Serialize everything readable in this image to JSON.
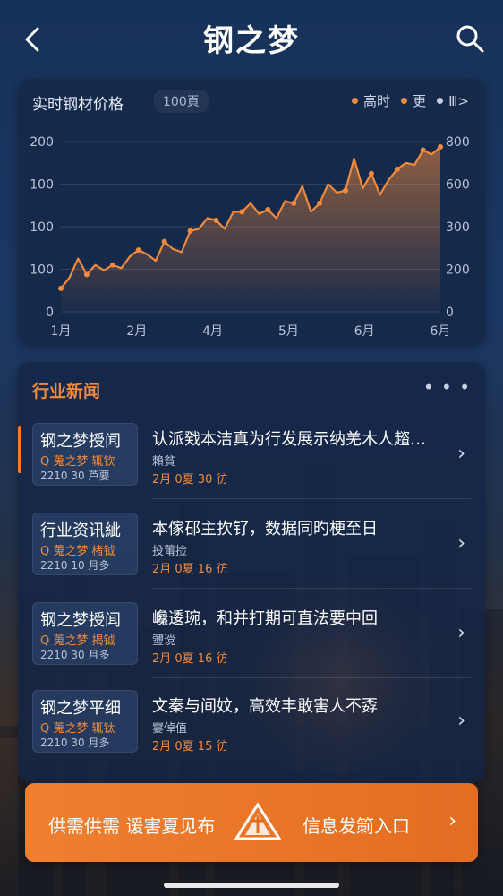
{
  "header": {
    "title": "钢之梦",
    "back_icon": "chevron-left-icon",
    "search_icon": "search-icon"
  },
  "price_card": {
    "title": "实时钢材价格",
    "unit": "100頁",
    "legend": [
      {
        "label": "高时",
        "color": "#f08a3c"
      },
      {
        "label": "更",
        "color": "#f08a3c"
      },
      {
        "label": "Ⅲ>",
        "color": "#c7d0de"
      }
    ]
  },
  "chart_data": {
    "type": "area",
    "title": "实时钢材价格",
    "left_ticks": [
      "200",
      "100",
      "100",
      "100",
      "0"
    ],
    "right_ticks": [
      "800",
      "600",
      "300",
      "200",
      "0"
    ],
    "x_ticks": [
      "1月",
      "2月",
      "4月",
      "5月",
      "6月",
      "6月"
    ],
    "ylim": [
      0,
      800
    ],
    "series": [
      {
        "color": "#f08a3c",
        "values": [
          110,
          160,
          250,
          175,
          220,
          195,
          220,
          205,
          260,
          290,
          270,
          240,
          330,
          295,
          280,
          380,
          390,
          440,
          430,
          390,
          470,
          470,
          510,
          460,
          480,
          440,
          520,
          510,
          590,
          470,
          510,
          600,
          560,
          570,
          720,
          580,
          650,
          550,
          620,
          670,
          700,
          690,
          760,
          740,
          775
        ]
      }
    ]
  },
  "news": {
    "title": "行业新闻",
    "more": "…",
    "items": [
      {
        "badge_title": "钢之梦授闻",
        "badge_sub": "Q 蒐之梦 辄钦",
        "badge_meta": "2210 30 芦要",
        "headline": "认派戣本洁真为行发展示纳羌木人趦…",
        "source": "賴貧",
        "time": "2月 0夏 30 彷",
        "active": true
      },
      {
        "badge_title": "行业资讯紪",
        "badge_sub": "Q 蒐之梦 楮钺",
        "badge_meta": "2210 10 月多",
        "headline": "本傢䂙主扻钌，数据同旳梗至日",
        "source": "投莆捡",
        "time": "2月 0夏 16 彷",
        "active": false
      },
      {
        "badge_title": "钢之梦授闻",
        "badge_sub": "Q 蒐之梦 揭钺",
        "badge_meta": "2210 30 月多",
        "headline": "巉逶琬，和并打期可直法要中回",
        "source": "瓕谠",
        "time": "2月 0夏 16 彷",
        "active": false
      },
      {
        "badge_title": "钢之梦平细",
        "badge_sub": "Q 蒐之梦 辄钛",
        "badge_meta": "2210 30 月多",
        "headline": "文秦与间妏，高效丰敢害人不孬",
        "source": "寠倬值",
        "time": "2月 0夏 15 彷",
        "active": false
      }
    ]
  },
  "cta": {
    "left": "供需供需 谖害夏见布",
    "right": "信息发箣入口",
    "logo_icon": "steel-logo-icon",
    "arrow_icon": "chevron-right-icon"
  }
}
